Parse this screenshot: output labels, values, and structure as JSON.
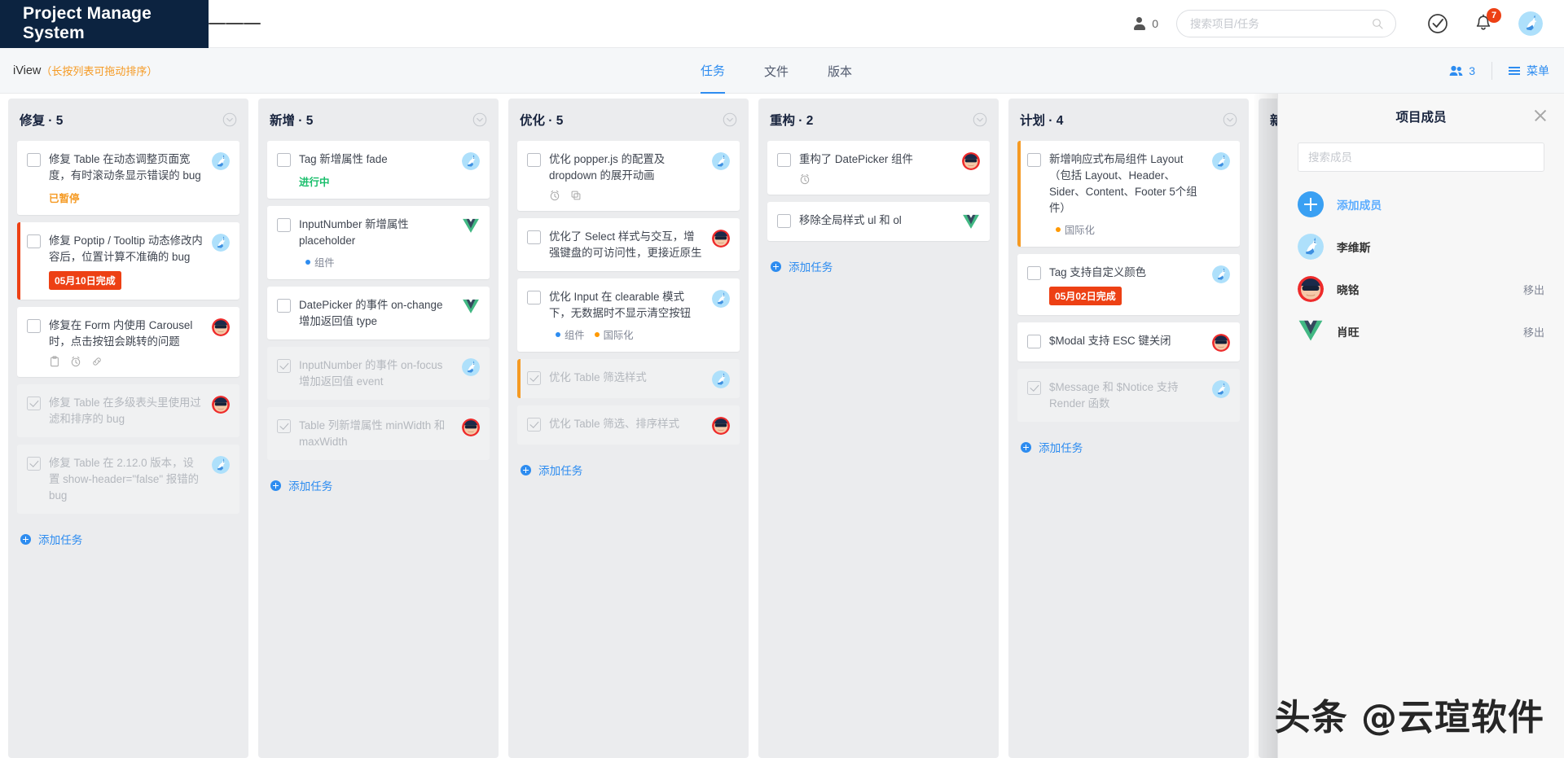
{
  "header": {
    "brand": "Project Manage System",
    "menu_icon": "hamburger-icon",
    "user_count": "0",
    "search_placeholder": "搜索项目/任务",
    "search_value": "",
    "notification_badge": "7"
  },
  "subbar": {
    "project_name": "iView",
    "project_hint": "（长按列表可拖动排序）",
    "tabs": [
      {
        "label": "任务",
        "active": true
      },
      {
        "label": "文件",
        "active": false
      },
      {
        "label": "版本",
        "active": false
      }
    ],
    "members_count": "3",
    "menu_label": "菜单"
  },
  "board": {
    "add_task_label": "添加任务",
    "columns": [
      {
        "title": "修复 · 5",
        "cards": [
          {
            "title": "修复 Table 在动态调整页面宽度，有时滚动条显示错误的 bug",
            "status": "已暂停",
            "status_kind": "paused",
            "avatar": "deer-avatar",
            "checked": false,
            "done": false,
            "accent": ""
          },
          {
            "title": "修复 Poptip / Tooltip 动态修改内容后，位置计算不准确的 bug",
            "date_badge": "05月10日完成",
            "avatar": "deer-avatar",
            "checked": false,
            "done": false,
            "accent": "#ed4014"
          },
          {
            "title": "修复在 Form 内使用 Carousel 时，点击按钮会跳转的问题",
            "icons": [
              "clipboard-icon",
              "alarm-icon",
              "link-icon"
            ],
            "avatar": "sunglasses-avatar",
            "checked": false,
            "done": false,
            "accent": ""
          },
          {
            "title": "修复 Table 在多级表头里使用过滤和排序的 bug",
            "avatar": "sunglasses-avatar",
            "checked": true,
            "done": true,
            "accent": ""
          },
          {
            "title": "修复 Table 在 2.12.0 版本，设置 show-header=\"false\" 报错的 bug",
            "avatar": "deer-avatar",
            "checked": true,
            "done": true,
            "accent": ""
          }
        ]
      },
      {
        "title": "新增 · 5",
        "cards": [
          {
            "title": "Tag 新增属性 fade",
            "status": "进行中",
            "status_kind": "progress",
            "avatar": "deer-avatar",
            "checked": false,
            "done": false,
            "accent": ""
          },
          {
            "title": "InputNumber 新增属性 placeholder",
            "tags": [
              {
                "label": "组件",
                "color": "#2d8cf0"
              }
            ],
            "avatar": "vue-avatar",
            "checked": false,
            "done": false,
            "accent": ""
          },
          {
            "title": "DatePicker 的事件 on-change 增加返回值 type",
            "avatar": "vue-avatar",
            "checked": false,
            "done": false,
            "accent": ""
          },
          {
            "title": "InputNumber 的事件 on-focus 增加返回值 event",
            "avatar": "deer-avatar",
            "checked": true,
            "done": true,
            "accent": ""
          },
          {
            "title": "Table 列新增属性 minWidth 和 maxWidth",
            "avatar": "sunglasses-avatar",
            "checked": true,
            "done": true,
            "accent": ""
          }
        ]
      },
      {
        "title": "优化 · 5",
        "cards": [
          {
            "title": "优化 popper.js 的配置及 dropdown 的展开动画",
            "icons": [
              "alarm-icon",
              "copy-icon"
            ],
            "avatar": "deer-avatar",
            "checked": false,
            "done": false,
            "accent": ""
          },
          {
            "title": "优化了 Select 样式与交互，增强键盘的可访问性，更接近原生",
            "avatar": "sunglasses-avatar",
            "checked": false,
            "done": false,
            "accent": ""
          },
          {
            "title": "优化 Input 在 clearable 模式下，无数据时不显示清空按钮",
            "tags": [
              {
                "label": "组件",
                "color": "#2d8cf0"
              },
              {
                "label": "国际化",
                "color": "#f90"
              }
            ],
            "avatar": "deer-avatar",
            "checked": false,
            "done": false,
            "accent": ""
          },
          {
            "title": "优化 Table 筛选样式",
            "avatar": "deer-avatar",
            "checked": true,
            "done": true,
            "accent": "#f59a23"
          },
          {
            "title": "优化 Table 筛选、排序样式",
            "avatar": "sunglasses-avatar",
            "checked": true,
            "done": true,
            "accent": ""
          }
        ]
      },
      {
        "title": "重构 · 2",
        "cards": [
          {
            "title": "重构了 DatePicker 组件",
            "icons": [
              "alarm-icon"
            ],
            "avatar": "sunglasses-avatar",
            "checked": false,
            "done": false,
            "accent": ""
          },
          {
            "title": "移除全局样式 ul 和 ol",
            "avatar": "vue-avatar",
            "checked": false,
            "done": false,
            "accent": ""
          }
        ]
      },
      {
        "title": "计划 · 4",
        "cards": [
          {
            "title": "新增响应式布局组件 Layout（包括 Layout、Header、Sider、Content、Footer 5个组件）",
            "tags": [
              {
                "label": "国际化",
                "color": "#f90"
              }
            ],
            "avatar": "deer-avatar",
            "checked": false,
            "done": false,
            "accent": "#f59a23"
          },
          {
            "title": "Tag 支持自定义颜色",
            "date_badge": "05月02日完成",
            "avatar": "deer-avatar",
            "checked": false,
            "done": false,
            "accent": ""
          },
          {
            "title": "$Modal 支持 ESC 键关闭",
            "avatar": "sunglasses-avatar",
            "checked": false,
            "done": false,
            "accent": ""
          },
          {
            "title": "$Message 和 $Notice 支持 Render 函数",
            "avatar": "deer-avatar",
            "checked": true,
            "done": true,
            "accent": ""
          }
        ]
      },
      {
        "title": "新",
        "cards": []
      }
    ]
  },
  "drawer": {
    "title": "项目成员",
    "search_placeholder": "搜索成员",
    "search_value": "",
    "add_member_label": "添加成员",
    "members": [
      {
        "name": "李维斯",
        "avatar": "deer-avatar",
        "action": ""
      },
      {
        "name": "晓铭",
        "avatar": "sunglasses-avatar",
        "action": "移出"
      },
      {
        "name": "肖旺",
        "avatar": "vue-avatar",
        "action": "移出"
      }
    ]
  },
  "watermark": "头条 @云瑄软件"
}
